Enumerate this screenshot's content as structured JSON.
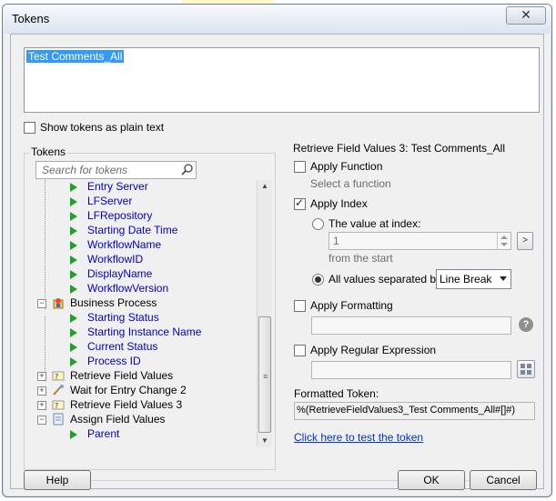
{
  "window": {
    "title": "Tokens",
    "close_glyph": "✕"
  },
  "token_text": {
    "selected_text": "Test Comments_All"
  },
  "show_plain": {
    "label": "Show tokens as plain text",
    "checked": false
  },
  "tokens_panel": {
    "title": "Tokens",
    "search_placeholder": "Search for tokens",
    "items": [
      {
        "label": "Entry Server"
      },
      {
        "label": "LFServer"
      },
      {
        "label": "LFRepository"
      },
      {
        "label": "Starting Date Time"
      },
      {
        "label": "WorkflowName"
      },
      {
        "label": "WorkflowID"
      },
      {
        "label": "DisplayName"
      },
      {
        "label": "WorkflowVersion"
      },
      {
        "label": "Business Process"
      },
      {
        "label": "Starting Status"
      },
      {
        "label": "Starting Instance Name"
      },
      {
        "label": "Current Status"
      },
      {
        "label": "Process ID"
      },
      {
        "label": "Retrieve Field Values"
      },
      {
        "label": "Wait for Entry Change 2"
      },
      {
        "label": "Retrieve Field Values 3"
      },
      {
        "label": "Assign Field Values"
      },
      {
        "label": "Parent"
      }
    ]
  },
  "right_panel": {
    "title": "Retrieve Field Values 3: Test Comments_All",
    "apply_function": {
      "label": "Apply Function",
      "checked": false,
      "hint": "Select a function"
    },
    "apply_index": {
      "label": "Apply Index",
      "checked": true,
      "value_at_index_label": "The value at index:",
      "index_value": "1",
      "from_start": "from the  start",
      "arrow_button": ">",
      "all_values_label": "All values separated by:",
      "separator_value": "Line Break"
    },
    "apply_formatting": {
      "label": "Apply Formatting",
      "checked": false,
      "help_glyph": "?"
    },
    "apply_regex": {
      "label": "Apply Regular Expression",
      "checked": false
    },
    "formatted_token_label": "Formatted Token:",
    "formatted_token_value": "%(RetrieveFieldValues3_Test Comments_All#[]#)",
    "test_link": "Click here to test the token"
  },
  "footer": {
    "help": "Help",
    "ok": "OK",
    "cancel": "Cancel"
  },
  "colors": {
    "selection": "#3399ff",
    "link": "#0033cc",
    "token_blue": "#0000cc",
    "play_green": "#22a12a"
  }
}
